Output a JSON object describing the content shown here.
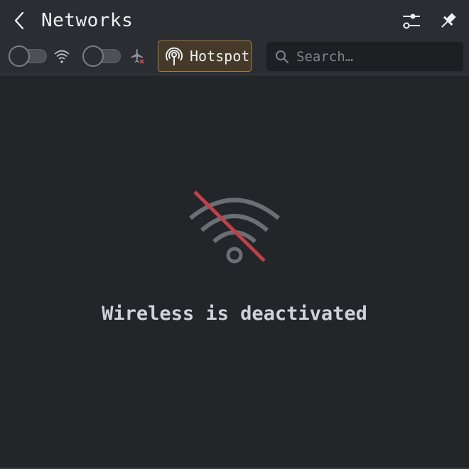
{
  "header": {
    "title": "Networks"
  },
  "toolbar": {
    "hotspot_label": "Hotspot",
    "search_placeholder": "Search…",
    "wifi_enabled": false,
    "airplane_mode_enabled": false
  },
  "icons": {
    "back": "chevron-left-icon",
    "configure": "sliders-icon",
    "pin": "pin-icon",
    "wifi": "wifi-icon",
    "airplane": "airplane-off-icon",
    "hotspot": "hotspot-icon",
    "search": "search-icon",
    "wifi_disabled": "wifi-off-icon"
  },
  "colors": {
    "background": "#232629",
    "header_background": "#2a2e32",
    "hotspot_border": "#a57d3f",
    "hotspot_background": "#45392a",
    "strike_red": "#c0404a",
    "muted_icon": "#6b6f74"
  },
  "main": {
    "empty_message": "Wireless is deactivated"
  }
}
